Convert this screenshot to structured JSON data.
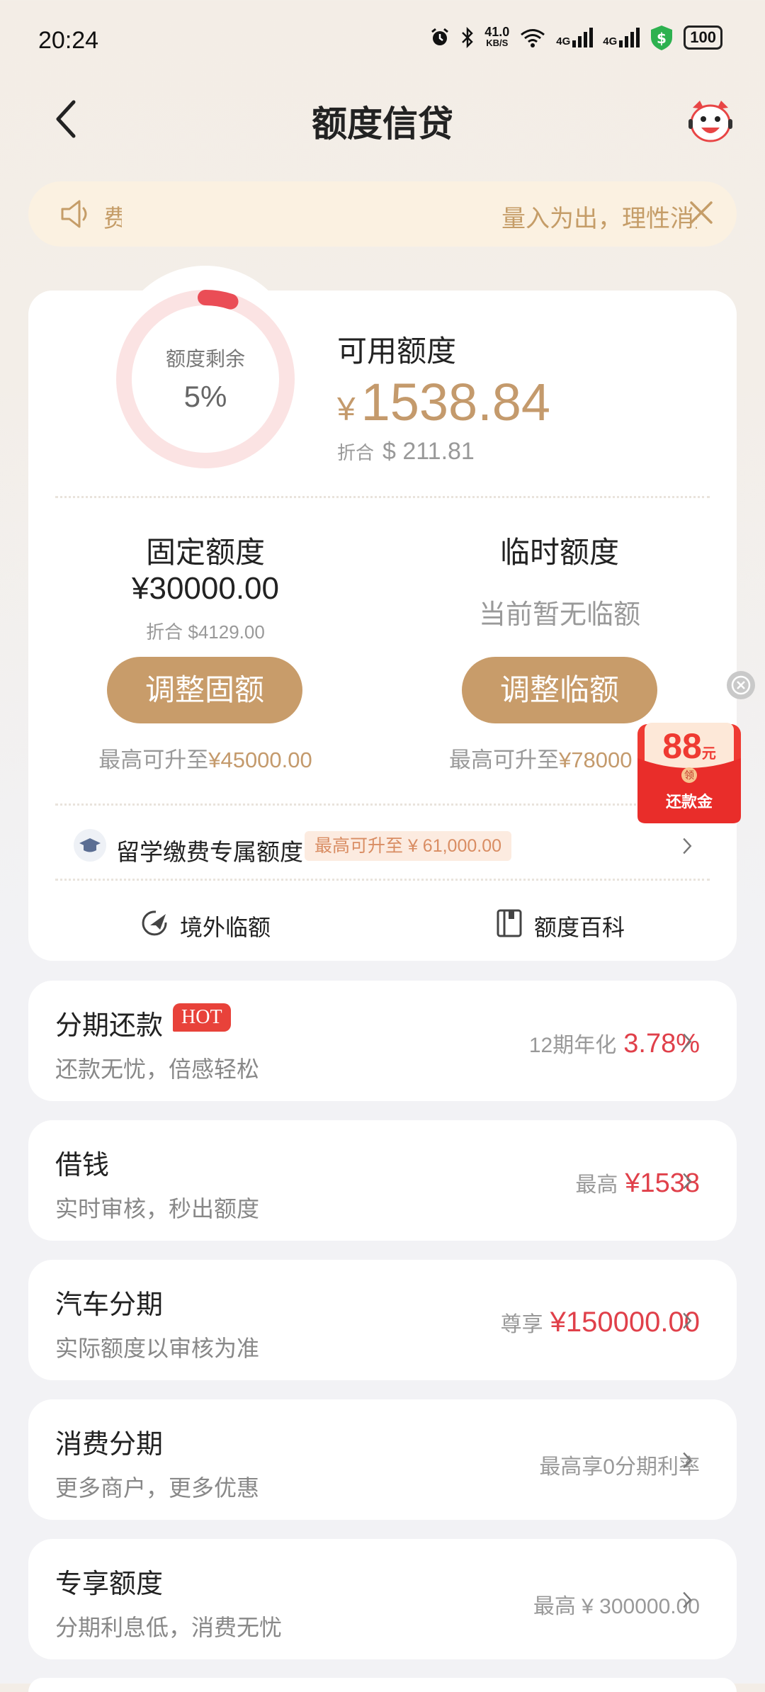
{
  "status_bar": {
    "time": "20:24",
    "net_speed_top": "41.0",
    "net_speed_bottom": "KB/S",
    "signal1": "4G",
    "signal2": "4G",
    "battery": "100"
  },
  "header": {
    "title": "额度信贷",
    "back_icon": "chevron-left-icon",
    "mascot_icon": "mascot-avatar-icon"
  },
  "notice": {
    "fragment": "费",
    "text": "量入为出，理性消费",
    "speaker_icon": "speaker-icon",
    "close_icon": "close-icon"
  },
  "quota": {
    "ring_label": "额度剩余",
    "ring_percent": "5%",
    "remaining_fraction": 0.05,
    "available_label": "可用额度",
    "currency_symbol": "¥",
    "available_amount": "1538.84",
    "usd_prefix": "折合",
    "usd_amount": "$ 211.81"
  },
  "fixed": {
    "title": "固定额度",
    "amount": "¥30000.00",
    "usd": "折合 $4129.00",
    "button": "调整固额",
    "note_prefix": "最高可升至",
    "note_value": "¥45000.00"
  },
  "temporary": {
    "title": "临时额度",
    "status": "当前暂无临额",
    "button": "调整临额",
    "note_prefix": "最高可升至",
    "note_value": "¥78000.00"
  },
  "study": {
    "label": "留学缴费专属额度",
    "tag": "最高可升至 ¥ 61,000.00"
  },
  "links": {
    "overseas": "境外临额",
    "wiki": "额度百科"
  },
  "rows": [
    {
      "title": "分期还款",
      "badge": "HOT",
      "subtitle": "还款无忧，倍感轻松",
      "right_label": "12期年化",
      "right_value": "3.78%"
    },
    {
      "title": "借钱",
      "subtitle": "实时审核，秒出额度",
      "right_label": "最高",
      "right_value": "¥1538"
    },
    {
      "title": "汽车分期",
      "subtitle": "实际额度以审核为准",
      "right_label": "尊享",
      "right_value": "¥150000.00"
    },
    {
      "title": "消费分期",
      "subtitle": "更多商户，更多优惠",
      "right_label": "最高享0分期利率",
      "right_value": ""
    },
    {
      "title": "专享额度",
      "subtitle": "分期利息低，消费无忧",
      "right_label": "最高 ¥ 300000.00",
      "right_value": ""
    }
  ],
  "coupon": {
    "amount": "88",
    "unit": "元",
    "label": "还款金",
    "badge": "领"
  },
  "colors": {
    "accent": "#c89c6a",
    "gold_text": "#c49a6c",
    "red": "#e0404a",
    "hot_badge": "#e8423a",
    "notice_bg": "#fbf1e1"
  }
}
